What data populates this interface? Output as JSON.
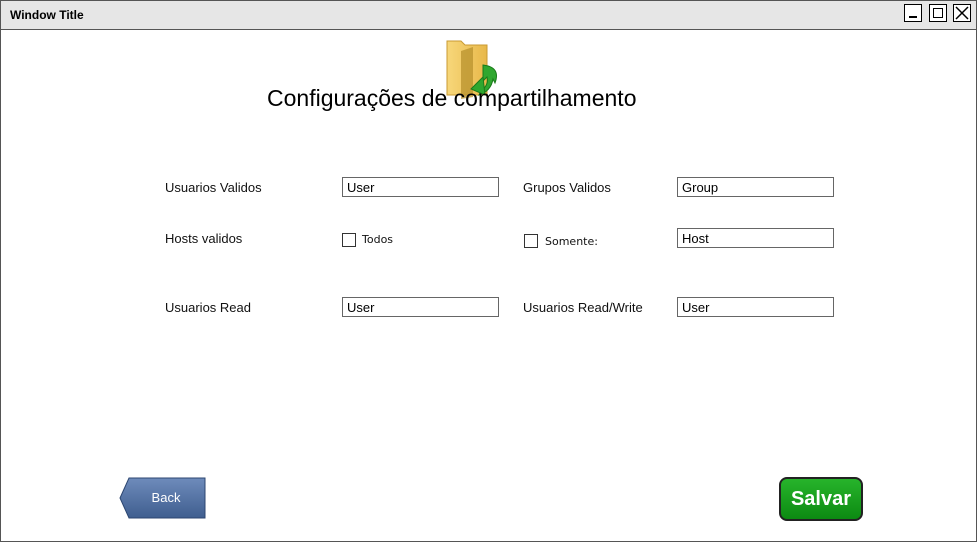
{
  "window": {
    "title": "Window Title"
  },
  "header": {
    "title": "Configurações de compartilhamento"
  },
  "form": {
    "usuarios_validos": {
      "label": "Usuarios Validos",
      "value": "User"
    },
    "grupos_validos": {
      "label": "Grupos Validos",
      "value": "Group"
    },
    "hosts_validos": {
      "label": "Hosts validos",
      "todos_label": "Todos",
      "todos_checked": false,
      "somente_label": "Somente:",
      "somente_checked": false,
      "value": "Host"
    },
    "usuarios_read": {
      "label": "Usuarios Read",
      "value": "User"
    },
    "usuarios_read_write": {
      "label": "Usuarios Read/Write",
      "value": "User"
    }
  },
  "actions": {
    "back_label": "Back",
    "save_label": "Salvar"
  },
  "colors": {
    "save": "#1a9e1f",
    "back": "#4f6fa0"
  },
  "icons": {
    "header_icon": "folder-arrow-icon"
  }
}
